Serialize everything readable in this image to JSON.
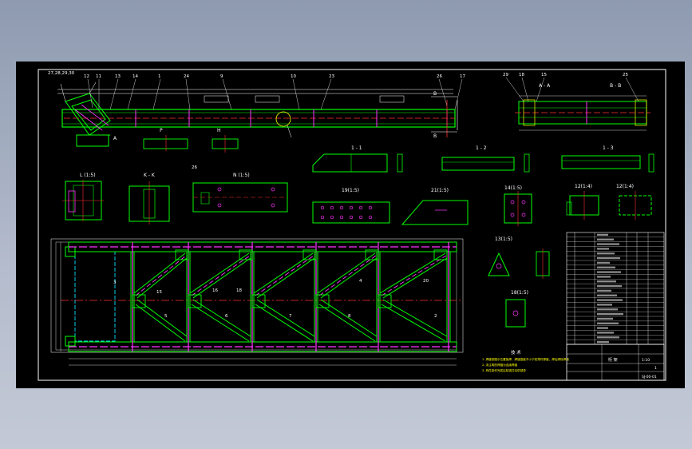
{
  "canvas": {
    "background": "#000000",
    "workspace_color": "#a9b3c6",
    "colors": {
      "outline": "#00ff00",
      "dim": "#ffffff",
      "center": "#ff3030",
      "hidden": "#ff33ff",
      "cyan": "#00e5ff",
      "yellow": "#ffff00"
    }
  },
  "views": {
    "elevation": {
      "balloons": [
        "27,28,29,30",
        "12",
        "11",
        "13",
        "14",
        "1",
        "24",
        "9",
        "10",
        "23",
        "26",
        "17"
      ],
      "section_marks": [
        "B",
        "B"
      ],
      "mark_a": "A",
      "detail_p": "P",
      "detail_h": "H"
    },
    "section_aa": {
      "balloons": [
        "29",
        "18",
        "15",
        "25"
      ],
      "label_a": "A - A",
      "label_b": "B - B"
    },
    "part_1_label": "1 - 1",
    "part_2_label": "1 - 2",
    "part_3_label": "1 - 3",
    "view_l": "L (1:5)",
    "view_k": "K - K",
    "view_n": "N (1:5)",
    "view_19": "19(1:5)",
    "view_21": "21(1:5)",
    "view_14": "14(1:5)",
    "view_12": "12(1:4)",
    "view_12b": "12(1:4)",
    "view_13": "13(1:5)",
    "view_18": "18(1:5)",
    "plan_balloons": [
      "3",
      "15",
      "16",
      "18",
      "5",
      "6",
      "7",
      "8",
      "2",
      "4",
      "20"
    ],
    "balloon_26": "26"
  },
  "notes": {
    "title": "技 术",
    "lines": [
      "1. 焊缝按图示位置施焊，焊缝高度不小于较薄件厚度，焊后清除焊渣",
      "2. 未注明的焊缝为连续焊缝",
      "3. 构件制作完成后除锈并涂防锈漆"
    ]
  },
  "title_block": {
    "drawing_title": "桁 架",
    "drawing_no": "SJ-00-01",
    "scale": "1:10",
    "sheet": "1"
  },
  "bom_rows": 24
}
